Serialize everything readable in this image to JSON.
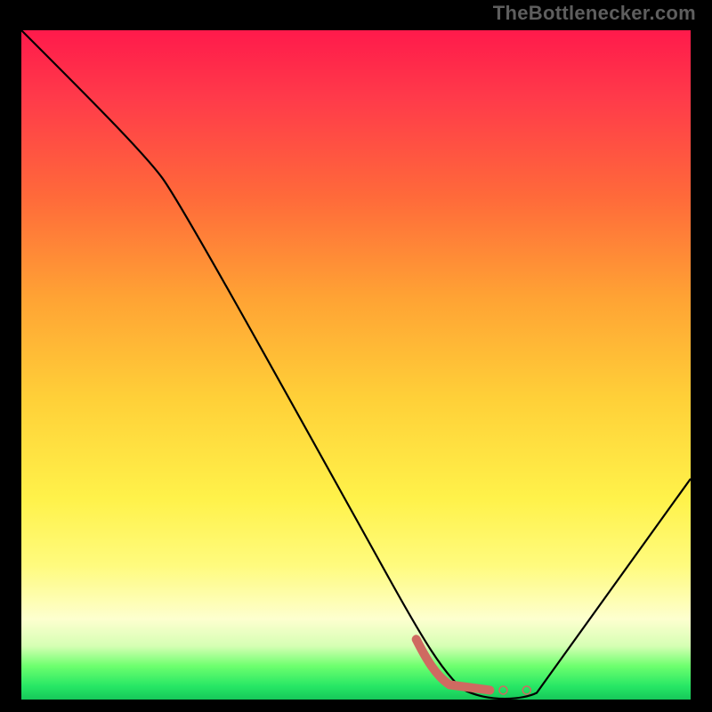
{
  "attribution": "TheBottlenecker.com",
  "chart_data": {
    "type": "line",
    "title": "",
    "xlabel": "",
    "ylabel": "",
    "xlim": [
      0,
      100
    ],
    "ylim": [
      0,
      100
    ],
    "series": [
      {
        "name": "bottleneck-curve",
        "x": [
          0,
          20,
          63,
          70,
          77,
          100
        ],
        "y": [
          100,
          80,
          4,
          0,
          0,
          32
        ]
      },
      {
        "name": "highlight-segment",
        "x": [
          60,
          63,
          70,
          72,
          74,
          75
        ],
        "y": [
          8,
          2,
          1,
          1,
          1,
          1
        ]
      }
    ],
    "colors": {
      "curve": "#000000",
      "highlight": "#cf6a61",
      "top": "#ff1a4b",
      "bottom": "#16c85a"
    }
  }
}
